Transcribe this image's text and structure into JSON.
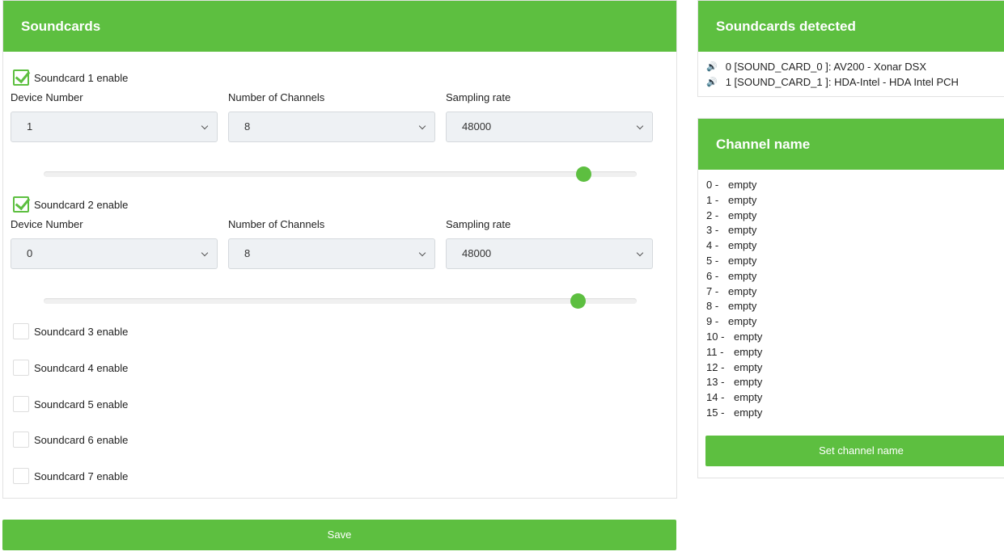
{
  "soundcards": {
    "title": "Soundcards",
    "cards": [
      {
        "label": "Soundcard 1 enable",
        "checked": true,
        "device_label": "Device Number",
        "device": "1",
        "channels_label": "Number of Channels",
        "channels": "8",
        "rate_label": "Sampling rate",
        "rate": "48000",
        "slider_fraction": 0.91
      },
      {
        "label": "Soundcard 2 enable",
        "checked": true,
        "device_label": "Device Number",
        "device": "0",
        "channels_label": "Number of Channels",
        "channels": "8",
        "rate_label": "Sampling rate",
        "rate": "48000",
        "slider_fraction": 0.9
      },
      {
        "label": "Soundcard 3 enable",
        "checked": false
      },
      {
        "label": "Soundcard 4 enable",
        "checked": false
      },
      {
        "label": "Soundcard 5 enable",
        "checked": false
      },
      {
        "label": "Soundcard 6 enable",
        "checked": false
      },
      {
        "label": "Soundcard 7 enable",
        "checked": false
      }
    ],
    "save_label": "Save"
  },
  "detected": {
    "title": "Soundcards detected",
    "icon": "speaker-icon",
    "items": [
      "0 [SOUND_CARD_0 ]: AV200 - Xonar DSX",
      "1 [SOUND_CARD_1 ]: HDA-Intel - HDA Intel PCH"
    ]
  },
  "channel_name": {
    "title": "Channel name",
    "items": [
      {
        "n": "0 -",
        "v": "empty"
      },
      {
        "n": "1 -",
        "v": "empty"
      },
      {
        "n": "2 -",
        "v": "empty"
      },
      {
        "n": "3 -",
        "v": "empty"
      },
      {
        "n": "4 -",
        "v": "empty"
      },
      {
        "n": "5 -",
        "v": "empty"
      },
      {
        "n": "6 -",
        "v": "empty"
      },
      {
        "n": "7 -",
        "v": "empty"
      },
      {
        "n": "8 -",
        "v": "empty"
      },
      {
        "n": "9 -",
        "v": "empty"
      },
      {
        "n": "10 -",
        "v": "empty"
      },
      {
        "n": "11 -",
        "v": "empty"
      },
      {
        "n": "12 -",
        "v": "empty"
      },
      {
        "n": "13 -",
        "v": "empty"
      },
      {
        "n": "14 -",
        "v": "empty"
      },
      {
        "n": "15 -",
        "v": "empty"
      }
    ],
    "button": "Set channel name"
  },
  "colors": {
    "accent": "#5dbf40"
  }
}
